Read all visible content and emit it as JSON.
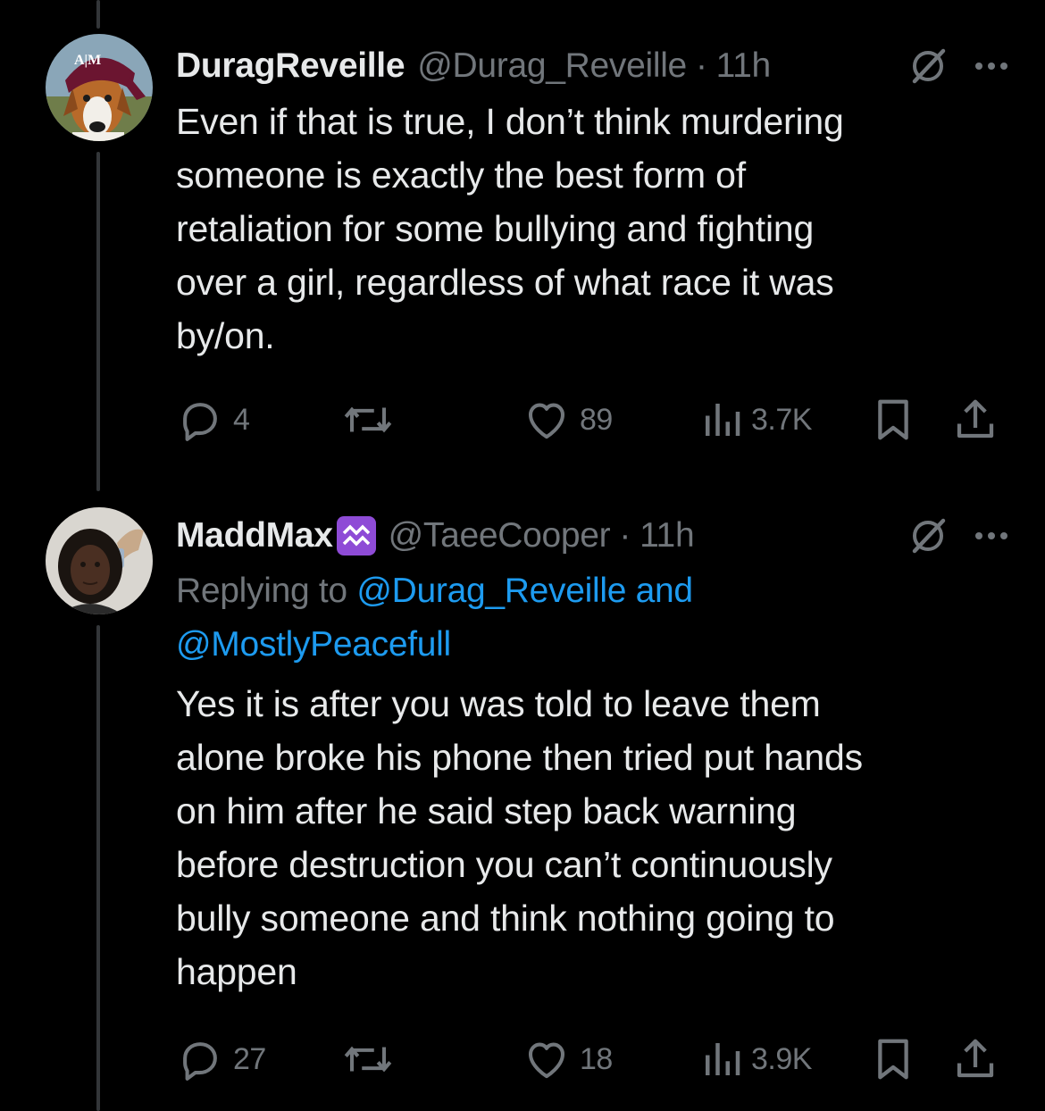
{
  "tweets": [
    {
      "display_name": "DuragReveille",
      "handle": "@Durag_Reveille",
      "separator": "·",
      "time": "11h",
      "avatar_icon": "collie-dog-with-atm-durag-avatar",
      "text": "Even if that is true, I don’t think murdering\nsomeone is exactly the best form of\nretaliation for some bullying and fighting\nover a girl, regardless of what race it was\nby/on.",
      "replies": "4",
      "reposts": "",
      "likes": "89",
      "views": "3.7K"
    },
    {
      "display_name": "MaddMax",
      "badge_icon": "aquarius-emoji-icon",
      "handle": "@TaeeCooper",
      "separator": "·",
      "time": "11h",
      "avatar_icon": "man-with-dreadlocks-avatar",
      "replying_to_label": "Replying to",
      "replying_to_users": "@Durag_Reveille and\n@MostlyPeacefull",
      "text": "Yes it is after you was told to leave them\nalone broke his phone then tried put hands\non him after he said step back warning\nbefore destruction you can’t continuously\nbully someone and think nothing going to\nhappen",
      "replies": "27",
      "reposts": "",
      "likes": "18",
      "views": "3.9K"
    }
  ],
  "colors": {
    "background": "#000000",
    "text_primary": "#e7e9ea",
    "text_secondary": "#71767b",
    "link": "#1d9bf0",
    "thread_line": "#333639",
    "aquarius_badge": "#8e4bd6"
  }
}
